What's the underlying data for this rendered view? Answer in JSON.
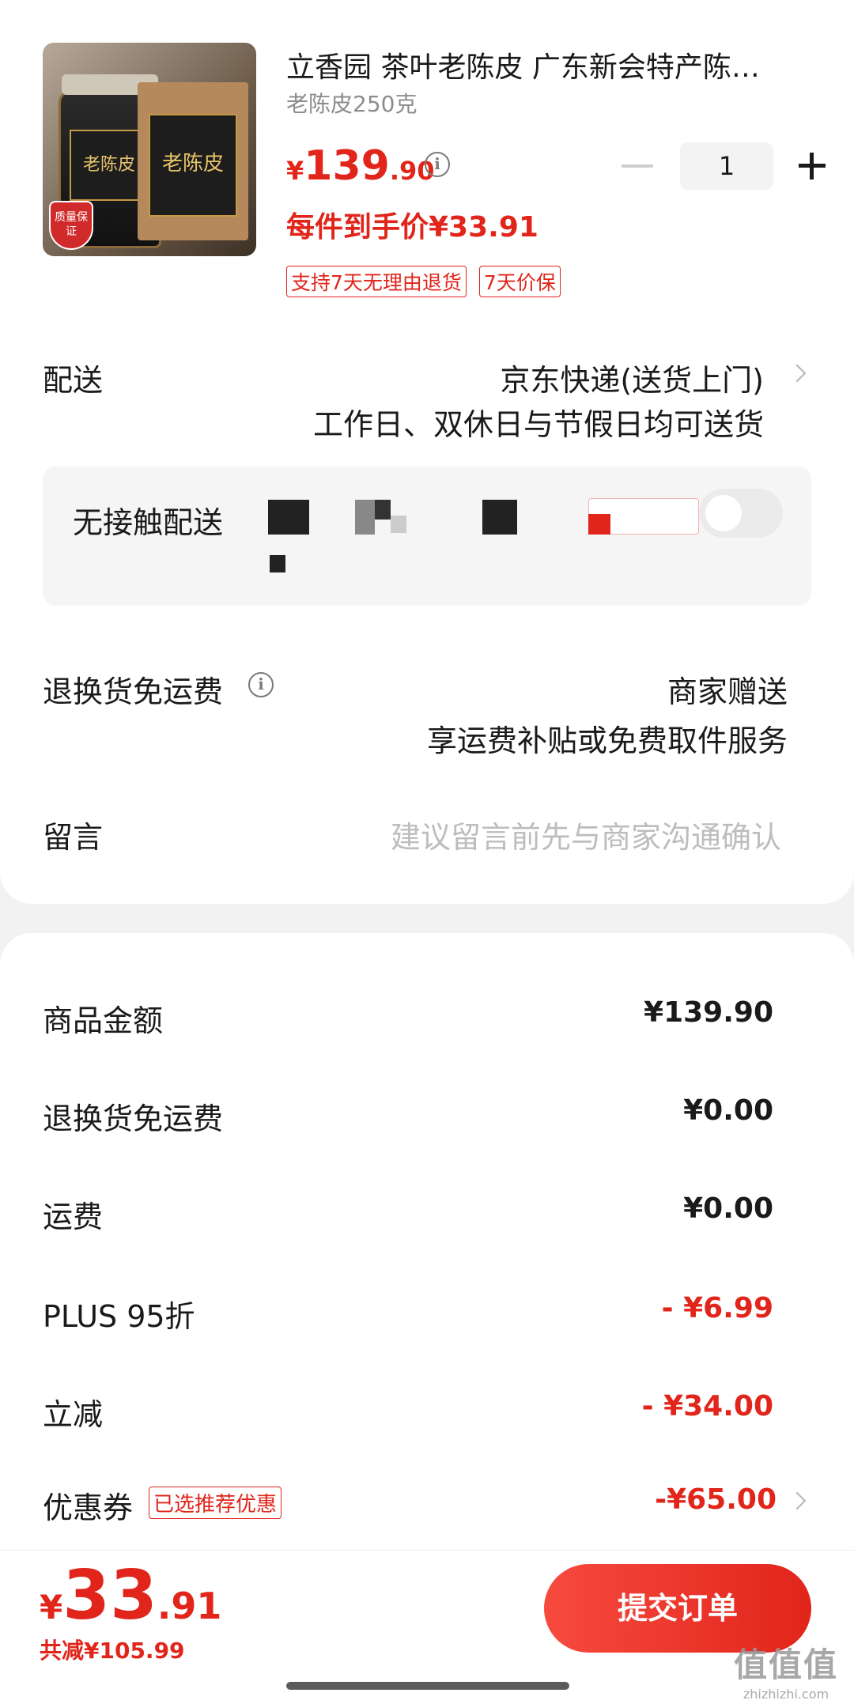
{
  "product": {
    "title": "立香园 茶叶老陈皮 广东新会特产陈…",
    "spec": "老陈皮250克",
    "price_currency": "¥",
    "price_int": "139",
    "price_dec": ".90",
    "deal_price": "每件到手价¥33.91",
    "tags": [
      "支持7天无理由退货",
      "7天价保"
    ],
    "quantity": "1",
    "image_text": {
      "jar": "老陈皮",
      "bag": "老陈皮",
      "badge": "质量保证"
    }
  },
  "delivery": {
    "label": "配送",
    "method": "京东快递(送货上门)",
    "schedule": "工作日、双休日与节假日均可送货"
  },
  "contactless": {
    "label": "无接触配送",
    "enabled": false
  },
  "return_shipping": {
    "label": "退换货免运费",
    "value": "商家赠送",
    "detail": "享运费补贴或免费取件服务"
  },
  "message": {
    "label": "留言",
    "placeholder": "建议留言前先与商家沟通确认"
  },
  "summary": {
    "goods_label": "商品金额",
    "goods_value": "¥139.90",
    "return_label": "退换货免运费",
    "return_value": "¥0.00",
    "freight_label": "运费",
    "freight_value": "¥0.00",
    "plus_label": "PLUS 95折",
    "plus_value": "- ¥6.99",
    "instant_label": "立减",
    "instant_value": "- ¥34.00",
    "coupon_label": "优惠券",
    "coupon_tag": "已选推荐优惠",
    "coupon_value": "-¥65.00"
  },
  "footer": {
    "total_currency": "¥",
    "total_int": "33",
    "total_dec": ".91",
    "saved": "共减¥105.99",
    "submit_label": "提交订单"
  },
  "watermark": {
    "line1": "值值值",
    "line2": "zhizhizhi.com"
  },
  "colors": {
    "accent": "#e1251b",
    "bg": "#f2f2f2"
  }
}
